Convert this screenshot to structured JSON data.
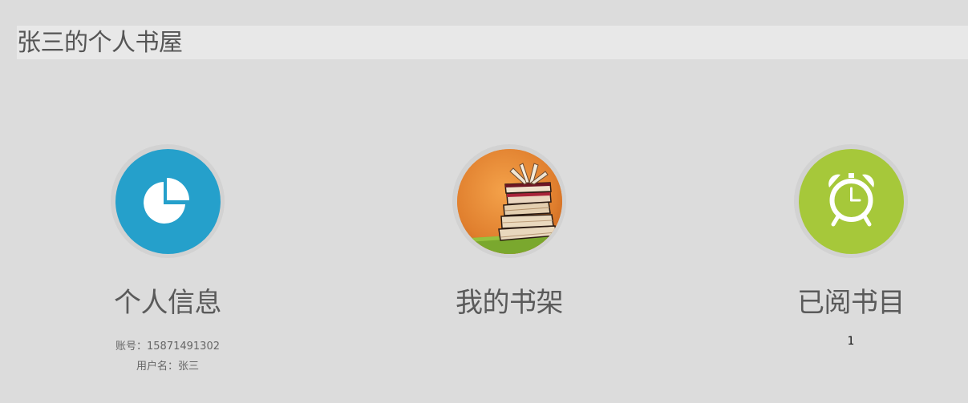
{
  "header": {
    "title": "张三的个人书屋"
  },
  "cards": [
    {
      "heading": "个人信息",
      "icon": "pie-chart-icon",
      "color": "#25a0cb",
      "details": [
        {
          "label": "账号：",
          "value": "15871491302"
        },
        {
          "label": "用户名：",
          "value": "张三"
        }
      ]
    },
    {
      "heading": "我的书架",
      "icon": "book-stack-image",
      "color": "#e58a3c"
    },
    {
      "heading": "已阅书目",
      "icon": "alarm-clock-icon",
      "color": "#a6c83a",
      "count": "1"
    }
  ]
}
